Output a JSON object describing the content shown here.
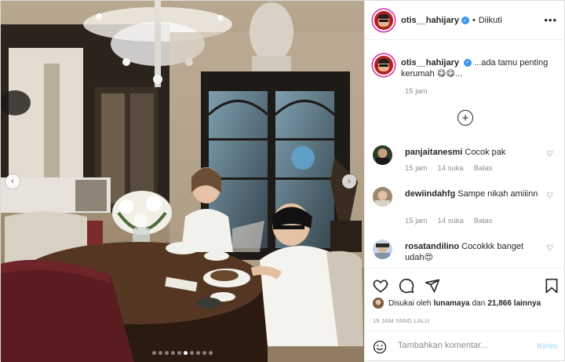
{
  "header": {
    "username": "otis__hahijary",
    "verified_mark": "✓",
    "separator": "•",
    "follow_status": "Diikuti",
    "more_icon": "more-horizontal-icon"
  },
  "caption": {
    "username": "otis__hahijary",
    "text": "...ada tamu penting kerumah 😋😋...",
    "time": "15 jam"
  },
  "load_more_icon": "plus-circle-icon",
  "comments": [
    {
      "username": "panjaitanesmi",
      "text": "Cocok pak",
      "time": "15 jam",
      "likes": "14 suka",
      "reply": "Balas"
    },
    {
      "username": "dewiindahfg",
      "text": "Sampe nikah amiiinn",
      "time": "15 jam",
      "likes": "14 suka",
      "reply": "Balas"
    },
    {
      "username": "rosatandilino",
      "text": "Cocokkk banget udah😍",
      "time": "",
      "likes": "",
      "reply": ""
    }
  ],
  "likes": {
    "prefix": "Disukai oleh",
    "first_user": "lunamaya",
    "connector": "dan",
    "others": "21,866 lainnya"
  },
  "post_date": "15 JAM YANG LALU",
  "comment_box": {
    "placeholder": "Tambahkan komentar...",
    "post_label": "Kirim"
  },
  "carousel": {
    "count": 10,
    "active_index": 5
  },
  "colors": {
    "verified": "#3897f0",
    "post_button_disabled": "#b2dffc",
    "muted_text": "#8e8e8e"
  }
}
